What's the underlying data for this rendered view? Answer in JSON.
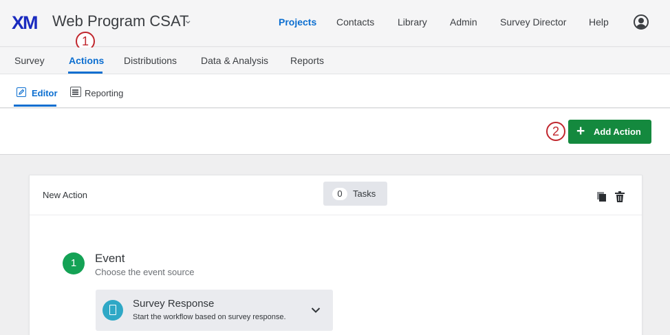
{
  "header": {
    "logo": "XM",
    "project_title": "Web Program CSAT",
    "nav": [
      "Projects",
      "Contacts",
      "Library",
      "Admin",
      "Survey Director",
      "Help"
    ],
    "active_nav": "Projects"
  },
  "project_tabs": {
    "items": [
      "Survey",
      "Actions",
      "Distributions",
      "Data & Analysis",
      "Reports"
    ],
    "active": "Actions"
  },
  "sub_tabs": {
    "items": [
      "Editor",
      "Reporting"
    ],
    "active": "Editor"
  },
  "toolbar": {
    "add_action_label": "Add Action"
  },
  "markers": [
    "1",
    "2"
  ],
  "action_card": {
    "title": "New Action",
    "tasks_count": "0",
    "tasks_label": "Tasks",
    "step": {
      "number": "1",
      "title": "Event",
      "subtitle": "Choose the event source"
    },
    "event_source": {
      "title": "Survey Response",
      "description": "Start the workflow based on survey response."
    }
  },
  "colors": {
    "accent_blue": "#0b6ed0",
    "logo_blue": "#1a2bbf",
    "button_green": "#14893e",
    "step_green": "#14a255",
    "marker_red": "#c0262d",
    "source_icon_teal": "#2fa8c6"
  }
}
